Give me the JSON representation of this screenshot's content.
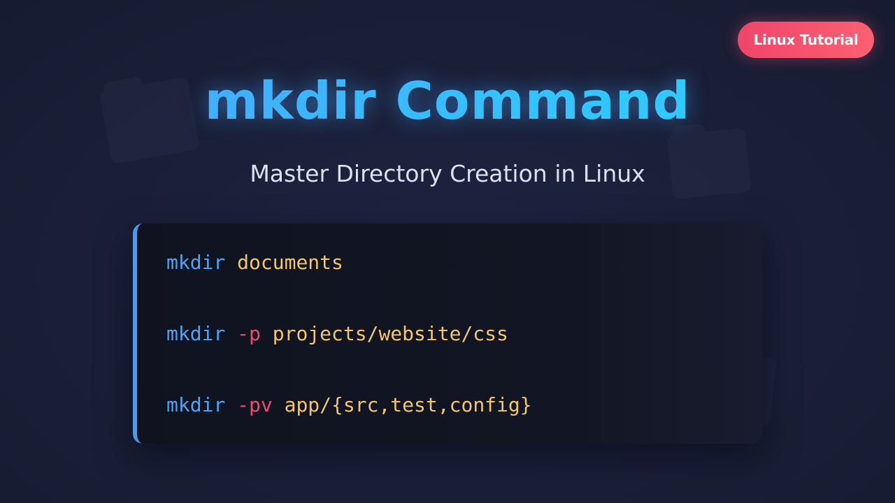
{
  "badge": {
    "label": "Linux Tutorial"
  },
  "title": "mkdir Command",
  "subtitle": "Master Directory Creation in Linux",
  "code_lines": [
    {
      "command": "mkdir",
      "flag": "",
      "argument": "documents"
    },
    {
      "command": "mkdir",
      "flag": "-p",
      "argument": "projects/website/css"
    },
    {
      "command": "mkdir",
      "flag": "-pv",
      "argument": "app/{src,test,config}"
    }
  ],
  "colors": {
    "command": "#4da3f5",
    "flag": "#ec4d6d",
    "argument": "#f5c56a",
    "accent_border": "#4a9bf0",
    "badge_start": "#f0456a",
    "badge_end": "#fb6072"
  },
  "icons": [
    "folder-icon",
    "folder-icon",
    "folder-icon",
    "folder-icon"
  ]
}
